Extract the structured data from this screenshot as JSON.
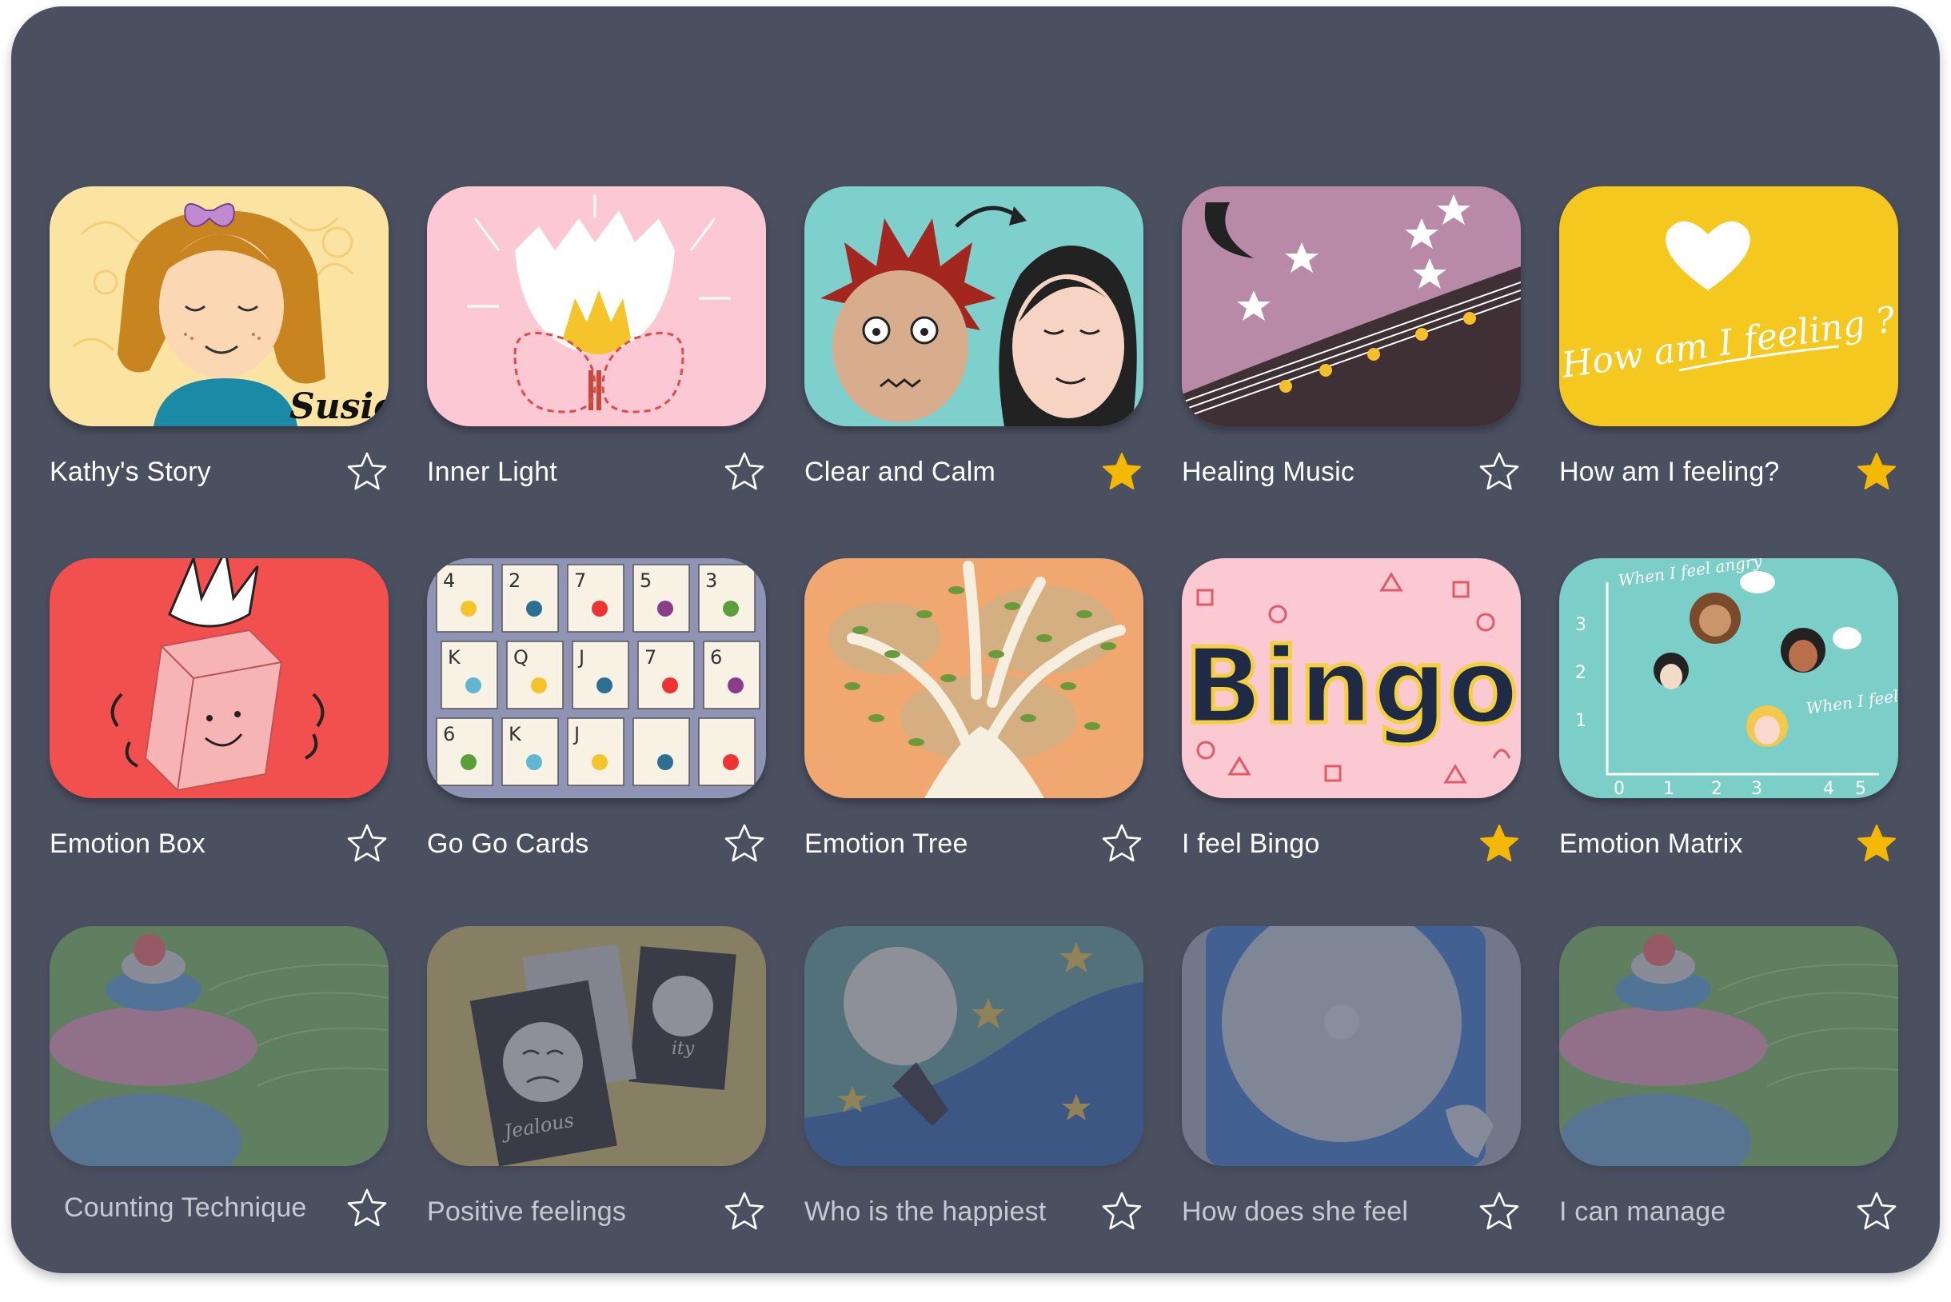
{
  "colors": {
    "background": "#4b5061",
    "star_on": "#f5b800",
    "star_off": "#ffffff"
  },
  "cards": [
    {
      "title": "Kathy's Story",
      "favorite": false,
      "locked": false
    },
    {
      "title": "Inner Light",
      "favorite": false,
      "locked": false
    },
    {
      "title": "Clear and Calm",
      "favorite": true,
      "locked": false
    },
    {
      "title": "Healing Music",
      "favorite": false,
      "locked": false
    },
    {
      "title": "How am I feeling?",
      "favorite": true,
      "locked": false
    },
    {
      "title": "Emotion Box",
      "favorite": false,
      "locked": false
    },
    {
      "title": "Go Go Cards",
      "favorite": false,
      "locked": false
    },
    {
      "title": "Emotion Tree",
      "favorite": false,
      "locked": false
    },
    {
      "title": "I feel Bingo",
      "favorite": true,
      "locked": false
    },
    {
      "title": "Emotion Matrix",
      "favorite": true,
      "locked": false
    },
    {
      "title": "Counting Technique",
      "favorite": false,
      "locked": true
    },
    {
      "title": "Positive feelings",
      "favorite": false,
      "locked": true
    },
    {
      "title": "Who is the happiest",
      "favorite": false,
      "locked": true
    },
    {
      "title": "How does she feel",
      "favorite": false,
      "locked": true
    },
    {
      "title": "I can manage",
      "favorite": false,
      "locked": true
    }
  ],
  "art_text": {
    "susie": "Susie",
    "how_feeling": "How am I feeling ?",
    "bingo": "Bingo",
    "when_angry": "When I feel angry",
    "when_happy": "When I feel Happy",
    "jealous": "Jealous",
    "gratitude": "ity",
    "matrix_ticks_x": [
      "0",
      "1",
      "2",
      "3",
      "4",
      "5"
    ],
    "matrix_ticks_y": [
      "3",
      "2",
      "1"
    ],
    "card_ranks": [
      "4",
      "2",
      "7",
      "5",
      "3",
      "K",
      "Q",
      "J",
      "7",
      "6",
      "6",
      "K",
      "J"
    ]
  }
}
